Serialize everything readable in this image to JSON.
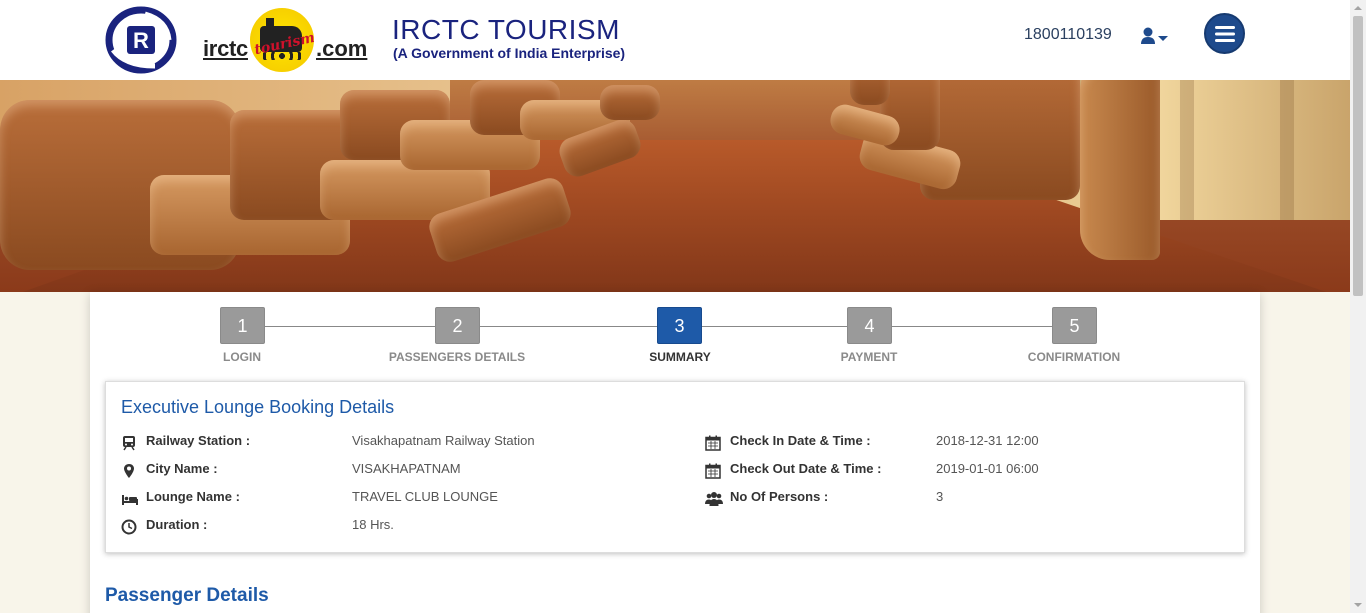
{
  "header": {
    "irctc_text": "irctc",
    "com_text": ".com",
    "badge_word": "tourism",
    "title": "IRCTC TOURISM",
    "subtitle": "(A Government of India Enterprise)",
    "phone": "1800110139"
  },
  "steps": [
    {
      "number": "1",
      "label": "LOGIN",
      "active": false
    },
    {
      "number": "2",
      "label": "PASSENGERS DETAILS",
      "active": false
    },
    {
      "number": "3",
      "label": "SUMMARY",
      "active": true
    },
    {
      "number": "4",
      "label": "PAYMENT",
      "active": false
    },
    {
      "number": "5",
      "label": "CONFIRMATION",
      "active": false
    }
  ],
  "booking": {
    "title": "Executive Lounge Booking Details",
    "left": [
      {
        "icon": "train-icon",
        "label": "Railway Station :",
        "value": "Visakhapatnam Railway Station"
      },
      {
        "icon": "map-marker-icon",
        "label": "City Name :",
        "value": "VISAKHAPATNAM"
      },
      {
        "icon": "bed-icon",
        "label": "Lounge Name :",
        "value": "TRAVEL CLUB LOUNGE"
      },
      {
        "icon": "clock-icon",
        "label": "Duration :",
        "value": "18 Hrs."
      }
    ],
    "right": [
      {
        "icon": "calendar-icon",
        "label": "Check In Date & Time :",
        "value": "2018-12-31 12:00"
      },
      {
        "icon": "calendar-icon",
        "label": "Check Out Date & Time :",
        "value": "2019-01-01 06:00"
      },
      {
        "icon": "users-icon",
        "label": "No Of Persons :",
        "value": "3"
      }
    ]
  },
  "passenger_section": {
    "title": "Passenger Details"
  },
  "colors": {
    "brand_blue": "#1e5aa8",
    "header_navy": "#1a237e",
    "step_inactive": "#9a9a9a"
  }
}
